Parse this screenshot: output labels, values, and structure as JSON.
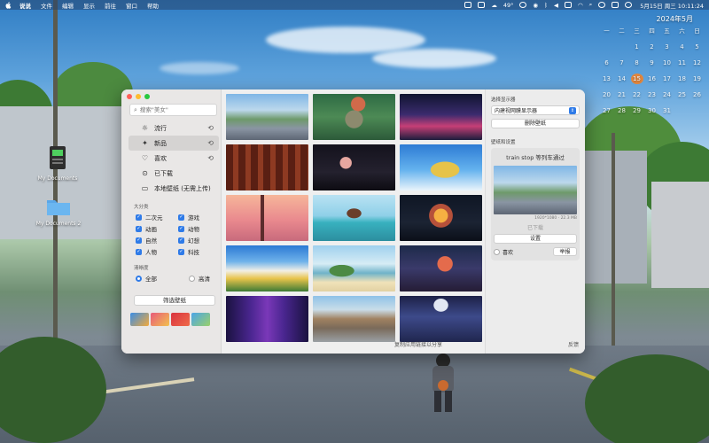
{
  "menubar": {
    "app_name": "说说",
    "items": [
      "文件",
      "编辑",
      "显示",
      "前往",
      "窗口",
      "帮助"
    ],
    "temperature": "49°",
    "datetime": "5月15日 周三  10:11:24"
  },
  "desktop": {
    "icons": [
      {
        "label": "My Documents"
      },
      {
        "label": "My Documents 2"
      }
    ]
  },
  "calendar": {
    "title": "2024年5月",
    "weekdays": [
      "一",
      "二",
      "三",
      "四",
      "五",
      "六",
      "日"
    ],
    "days": [
      "",
      "",
      "1",
      "2",
      "3",
      "4",
      "5",
      "6",
      "7",
      "8",
      "9",
      "10",
      "11",
      "12",
      "13",
      "14",
      "15",
      "16",
      "17",
      "18",
      "19",
      "20",
      "21",
      "22",
      "23",
      "24",
      "25",
      "26",
      "27",
      "28",
      "29",
      "30",
      "31",
      "",
      ""
    ],
    "today": "15"
  },
  "sidebar": {
    "search_placeholder": "搜索\"美女\"",
    "nav": [
      {
        "label": "流行",
        "icon": "sun-icon"
      },
      {
        "label": "新品",
        "icon": "sparkle-icon"
      },
      {
        "label": "喜欢",
        "icon": "heart-icon"
      },
      {
        "label": "已下载",
        "icon": "download-icon"
      },
      {
        "label": "本地壁纸 (无需上传)",
        "icon": "monitor-icon"
      }
    ],
    "category_label": "大分类",
    "categories": [
      "二次元",
      "游戏",
      "动画",
      "动物",
      "自然",
      "幻想",
      "人物",
      "科技"
    ],
    "resolution_label": "清晰度",
    "resolution_options": [
      "全部",
      "高清"
    ],
    "filter_button": "筛选壁纸"
  },
  "right_panel": {
    "display_label": "选择显示器",
    "display_value": "内建视网膜显示器",
    "delete_button": "删除壁纸",
    "preview_label": "壁纸和设置",
    "preview_title": "train stop 等列车通过",
    "preview_meta": "1920*1080 · 22.3 MB",
    "downloaded": "已下载",
    "set_button": "设置",
    "favorite": "喜欢",
    "report": "举报",
    "footer_share": "复制应用链接以分享",
    "footer_feedback": "反馈"
  },
  "colors": {
    "accent": "#2f7be8",
    "today": "#f0832c"
  }
}
